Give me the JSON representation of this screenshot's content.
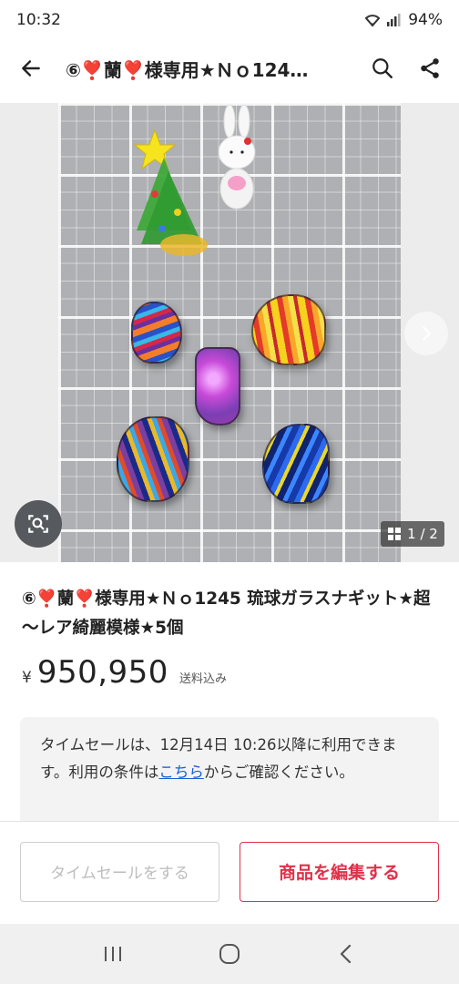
{
  "status_bar": {
    "time": "10:32",
    "battery": "94%"
  },
  "app_bar": {
    "title": "⑥❣️蘭❣️様専用★Ｎｏ124…",
    "back_icon": "arrow-left-icon",
    "search_icon": "search-icon",
    "share_icon": "share-icon"
  },
  "gallery": {
    "counter": "1 / 2",
    "next_icon": "chevron-right-icon",
    "scan_icon": "image-search-icon"
  },
  "item": {
    "title": "⑥❣️蘭❣️様専用★Ｎｏ1245 琉球ガラスナギット★超～レア綺麗模様★5個",
    "currency": "¥",
    "price": "950,950",
    "shipping": "送料込み"
  },
  "notice": {
    "text_before": "タイムセールは、12月14日 10:26以降に利用できます。利用の条件は",
    "link": "こちら",
    "text_after": "からご確認ください。"
  },
  "actions": {
    "timesale_label": "タイムセールをする",
    "edit_label": "商品を編集する"
  },
  "colors": {
    "accent": "#e0314a",
    "link": "#1a5fd0"
  }
}
